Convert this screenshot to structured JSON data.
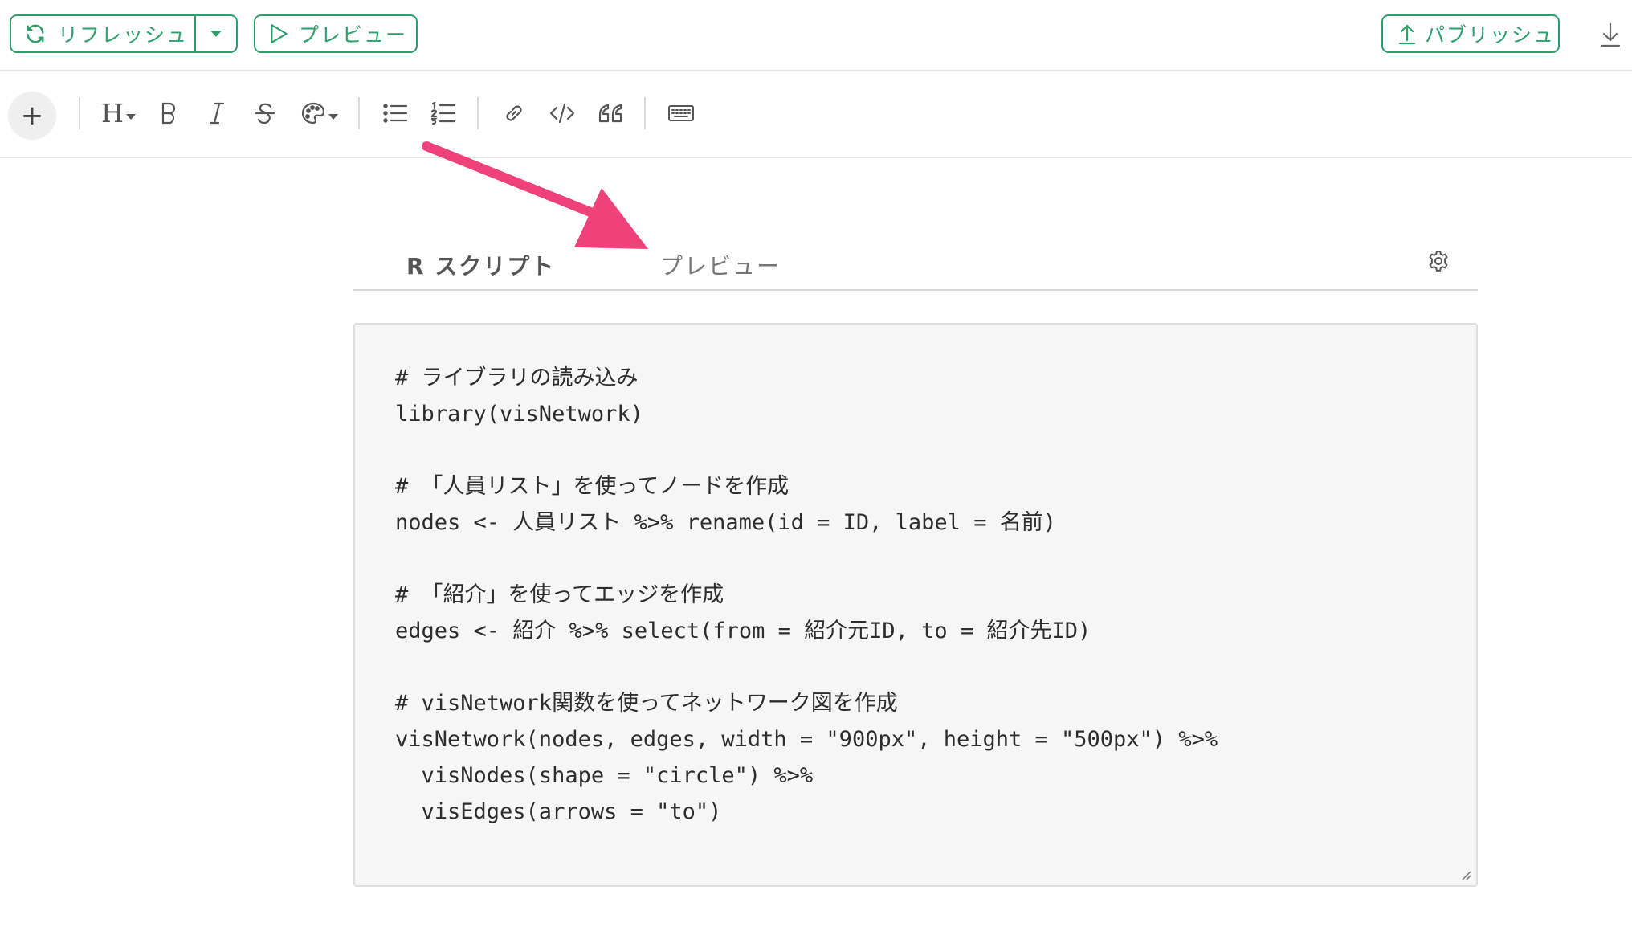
{
  "topbar": {
    "refresh_label": "リフレッシュ",
    "preview_label": "プレビュー",
    "publish_label": "パブリッシュ"
  },
  "toolbar": {
    "add_label": "+",
    "heading_label": "H"
  },
  "tabs": {
    "rscript_label": "R スクリプト",
    "preview_label": "プレビュー"
  },
  "editor": {
    "lines": [
      "# ライブラリの読み込み",
      "library(visNetwork)",
      "",
      "# 「人員リスト」を使ってノードを作成",
      "nodes <- 人員リスト %>% rename(id = ID, label = 名前)",
      "",
      "# 「紹介」を使ってエッジを作成",
      "edges <- 紹介 %>% select(from = 紹介元ID, to = 紹介先ID)",
      "",
      "# visNetwork関数を使ってネットワーク図を作成",
      "visNetwork(nodes, edges, width = \"900px\", height = \"500px\") %>%",
      "  visNodes(shape = \"circle\") %>%",
      "  visEdges(arrows = \"to\")"
    ]
  },
  "colors": {
    "accent_green": "#2e9e6a",
    "arrow_pink": "#f0427a"
  },
  "icons": [
    "refresh-icon",
    "caret-down-icon",
    "play-icon",
    "upload-icon",
    "download-icon",
    "bold-icon",
    "italic-icon",
    "strikethrough-icon",
    "palette-icon",
    "bullet-list-icon",
    "numbered-list-icon",
    "link-icon",
    "code-icon",
    "quote-icon",
    "keyboard-icon",
    "gear-icon"
  ]
}
